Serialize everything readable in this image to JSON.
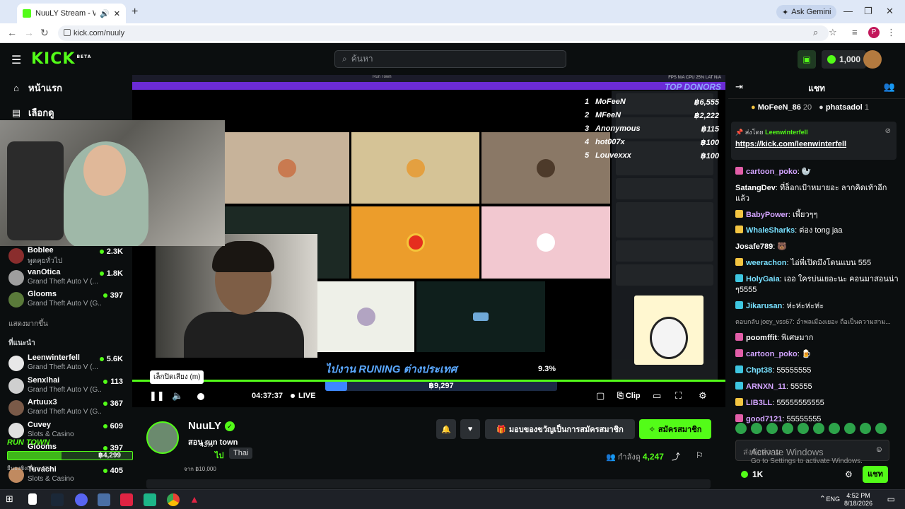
{
  "browser": {
    "tab_title": "NuuLY Stream - Watch Live",
    "gemini_label": "Ask Gemini",
    "url": "kick.com/nuuly",
    "profile_initial": "P"
  },
  "header": {
    "logo": "KICK",
    "logo_badge": "BETA",
    "search_placeholder": "ค้นหา",
    "kicks_count": "1,000"
  },
  "sidebar": {
    "nav": [
      {
        "label": "หน้าแรก",
        "icon": "home-icon"
      },
      {
        "label": "เลือกดู",
        "icon": "browse-icon"
      }
    ],
    "following": [
      {
        "name": "Boblee",
        "game": "พูดคุยทั่วไป",
        "viewers": "2.3K"
      },
      {
        "name": "vanOtica",
        "game": "Grand Theft Auto V (...",
        "viewers": "1.8K"
      },
      {
        "name": "Glooms",
        "game": "Grand Theft Auto V (G...",
        "viewers": "397"
      }
    ],
    "show_more": "แสดงมากขึ้น",
    "recommended_title": "ที่แนะนำ",
    "recommended": [
      {
        "name": "Leenwinterfell",
        "game": "Grand Theft Auto V (...",
        "viewers": "5.6K"
      },
      {
        "name": "Senxlhai",
        "game": "Grand Theft Auto V (G...",
        "viewers": "113"
      },
      {
        "name": "Artuux3",
        "game": "Grand Theft Auto V (G...",
        "viewers": "367"
      },
      {
        "name": "Cuvey",
        "game": "Slots & Casino",
        "viewers": "609"
      },
      {
        "name": "Glooms",
        "game": "",
        "viewers": "397"
      },
      {
        "name": "Tuvachi",
        "game": "Slots & Casino",
        "viewers": "405"
      }
    ]
  },
  "video": {
    "overlay_top": "Run Town",
    "stats": "FPS N/A  CPU 25%  LAT N/A",
    "top_donors_title": "TOP DONORS",
    "donors": [
      {
        "rank": "1",
        "name": "MoFeeN",
        "amount": "฿6,555"
      },
      {
        "rank": "2",
        "name": "MFeeN",
        "amount": "฿2,222"
      },
      {
        "rank": "3",
        "name": "Anonymous",
        "amount": "฿115"
      },
      {
        "rank": "4",
        "name": "hot007x",
        "amount": "฿100"
      },
      {
        "rank": "5",
        "name": "Louvexxx",
        "amount": "฿100"
      }
    ],
    "goal_title": "ไปงาน RUNING ต่างประเทศ",
    "goal_percent": "9.3%",
    "goal_amount": "฿9,297",
    "goal_fill_fraction": 0.093,
    "tooltip": "เล็กปิดเสียง (m)",
    "timer": "04:37:37",
    "live_label": "LIVE",
    "clip_label": "Clip"
  },
  "overlay_goal": {
    "title": "RUN TOWN",
    "amount": "฿4,299",
    "percent": "43%",
    "label": "ยืนยงชิงเพื่อน 4%",
    "target": "จาก ฿10,000",
    "fill_fraction": 0.43
  },
  "stream": {
    "name": "NuuLY",
    "title": "สอน run town",
    "category": "ไป",
    "language": "Thai",
    "gift_label": "มอบของขวัญเป็นการสมัครสมาชิก",
    "subscribe_label": "สมัครสมาชิก",
    "viewers_label": "กำลังดู",
    "viewers": "4,247"
  },
  "chat": {
    "title": "แชท",
    "top_gifters": [
      {
        "name": "MoFeeN_86",
        "count": "20"
      },
      {
        "name": "phatsadol",
        "count": "1"
      }
    ],
    "pinned_by_label": "ส่งโดย",
    "pinned_by": "Leenwinterfell",
    "pinned_link": "https://kick.com/leenwinterfell",
    "messages": [
      {
        "user": "cartoon_poko",
        "color": "#d3a4ff",
        "badge": "#e25ea8",
        "text": "🦭"
      },
      {
        "user": "SatangDev",
        "color": "#ffffff",
        "badge": "",
        "text": "ที่ล็อกเป้าหมายอะ ลากคิดเท้าอีกแล้ว"
      },
      {
        "user": "BabyPower",
        "color": "#d3a4ff",
        "badge": "#f4c542",
        "text": "เพี้ยวๆๆ"
      },
      {
        "user": "WhaleSharks",
        "color": "#78e0ff",
        "badge": "#f4c542",
        "text": "ต่อง tong jaa"
      },
      {
        "user": "Josafe789",
        "color": "#ffffff",
        "badge": "",
        "text": "🐻"
      },
      {
        "user": "weerachon",
        "color": "#78e0ff",
        "badge": "#f4c542",
        "text": "ไอ่พี่เปิดมึงโดนแบน 555"
      },
      {
        "user": "HolyGaia",
        "color": "#78e0ff",
        "badge": "#3ec6e0",
        "text": "เออ ใครบ่นเยอะนะ คอนมาสอนน่า ๆ5555"
      },
      {
        "user": "Jikarusan",
        "color": "#78e0ff",
        "badge": "#3ec6e0",
        "text": "ห่ะห่ะห่ะห่ะ"
      },
      {
        "user": "",
        "color": "#aaaaaa",
        "badge": "",
        "text": "ตอบกลับ joey_vss67: อำพลเมืองเยอะ ถือเป็นความสาม..."
      },
      {
        "user": "poomffit",
        "color": "#ffffff",
        "badge": "#e25ea8",
        "text": "พิเศษมาก"
      },
      {
        "user": "cartoon_poko",
        "color": "#d3a4ff",
        "badge": "#e25ea8",
        "text": "🍺"
      },
      {
        "user": "Chpt38",
        "color": "#78e0ff",
        "badge": "#3ec6e0",
        "text": "55555555"
      },
      {
        "user": "ARNXN_11",
        "color": "#d3a4ff",
        "badge": "#3ec6e0",
        "text": "55555"
      },
      {
        "user": "LIB3LL",
        "color": "#d3a4ff",
        "badge": "#f4c542",
        "text": "55555555555"
      },
      {
        "user": "good7121",
        "color": "#d3a4ff",
        "badge": "#e25ea8",
        "text": "55555555"
      }
    ],
    "input_placeholder": "ส่งข้อความ",
    "watermark_1": "Activate Windows",
    "watermark_2": "Go to Settings to activate Windows.",
    "kicks_balance": "1K",
    "send_label": "แชท"
  },
  "taskbar": {
    "lang": "ENG",
    "time": "4:52 PM",
    "date": "8/18/2026"
  }
}
